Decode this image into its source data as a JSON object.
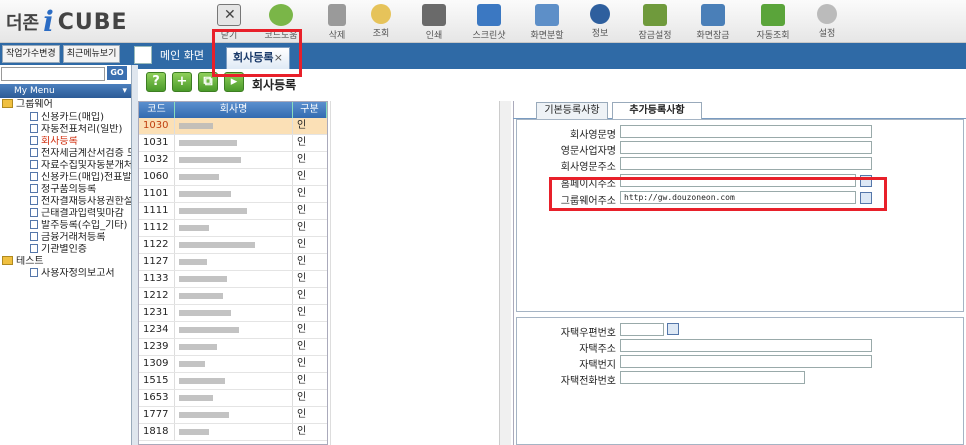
{
  "app": {
    "logo_brand": "더존",
    "logo_i": "i",
    "logo_product": "CUBE"
  },
  "toolbar": [
    {
      "label": "닫기",
      "icon": "close-window-icon"
    },
    {
      "label": "코드도움",
      "icon": "code-help-icon"
    },
    {
      "label": "삭제",
      "icon": "delete-icon"
    },
    {
      "label": "조회",
      "icon": "search-icon"
    },
    {
      "label": "인쇄",
      "icon": "printer-icon"
    },
    {
      "label": "스크린샷",
      "icon": "screenshot-icon"
    },
    {
      "label": "화면분할",
      "icon": "split-screen-icon"
    },
    {
      "label": "정보",
      "icon": "info-icon"
    },
    {
      "label": "잠금설정",
      "icon": "lock-settings-icon"
    },
    {
      "label": "화면잠금",
      "icon": "screen-lock-icon"
    },
    {
      "label": "자동조회",
      "icon": "auto-query-icon"
    },
    {
      "label": "설정",
      "icon": "gear-icon"
    }
  ],
  "left_tools": {
    "work_count_btn": "작업가수변경",
    "recent_menu_btn": "최근메뉴보기",
    "go_btn": "GO"
  },
  "tabs": {
    "main": "메인 화면",
    "company": "회사등록",
    "close": "×"
  },
  "mymenu": {
    "title": "My Menu"
  },
  "tree": [
    {
      "label": "그룹웨어",
      "type": "folder",
      "level": 0
    },
    {
      "label": "신용카드(매입)",
      "type": "page",
      "level": 1
    },
    {
      "label": "자동전표처리(일반)",
      "type": "page",
      "level": 1
    },
    {
      "label": "회사등록",
      "type": "page",
      "level": 1,
      "active": true
    },
    {
      "label": "전자세금계산서검증 도",
      "type": "page",
      "level": 1
    },
    {
      "label": "자료수집및자동분개처",
      "type": "page",
      "level": 1
    },
    {
      "label": "신용카드(매입)전표발",
      "type": "page",
      "level": 1
    },
    {
      "label": "청구품의등록",
      "type": "page",
      "level": 1
    },
    {
      "label": "전자결재등사용권한설",
      "type": "page",
      "level": 1
    },
    {
      "label": "근태결과입력및마감",
      "type": "page",
      "level": 1
    },
    {
      "label": "발주등록(수입_기타)",
      "type": "page",
      "level": 1
    },
    {
      "label": "금융거래처등록",
      "type": "page",
      "level": 1
    },
    {
      "label": "기관별인증",
      "type": "page",
      "level": 1
    },
    {
      "label": "테스트",
      "type": "folder",
      "level": 0
    },
    {
      "label": "사용자정의보고서",
      "type": "page",
      "level": 1
    }
  ],
  "page": {
    "title": "회사등록"
  },
  "grid": {
    "headers": [
      "코드",
      "회사명",
      "구분"
    ],
    "rows": [
      {
        "code": "1030",
        "type": "인",
        "selected": true
      },
      {
        "code": "1031",
        "type": "인"
      },
      {
        "code": "1032",
        "type": "인"
      },
      {
        "code": "1060",
        "type": "인"
      },
      {
        "code": "1101",
        "type": "인"
      },
      {
        "code": "1111",
        "type": "인"
      },
      {
        "code": "1112",
        "type": "인"
      },
      {
        "code": "1122",
        "type": "인"
      },
      {
        "code": "1127",
        "type": "인"
      },
      {
        "code": "1133",
        "type": "인"
      },
      {
        "code": "1212",
        "type": "인"
      },
      {
        "code": "1231",
        "type": "인"
      },
      {
        "code": "1234",
        "type": "인"
      },
      {
        "code": "1239",
        "type": "인"
      },
      {
        "code": "1309",
        "type": "인"
      },
      {
        "code": "1515",
        "type": "인"
      },
      {
        "code": "1653",
        "type": "인"
      },
      {
        "code": "1777",
        "type": "인"
      },
      {
        "code": "1818",
        "type": "인"
      }
    ]
  },
  "subtabs": {
    "basic": "기본등록사항",
    "extra": "추가등록사항"
  },
  "form_top": [
    {
      "label": "회사영문명",
      "value": ""
    },
    {
      "label": "영문사업자명",
      "value": ""
    },
    {
      "label": "회사영문주소",
      "value": ""
    },
    {
      "label": "홈페이지주소",
      "value": ""
    },
    {
      "label": "그룹웨어주소",
      "value": "http://gw.douzoneon.com"
    }
  ],
  "form_bottom": [
    {
      "label": "자택우편번호",
      "value": ""
    },
    {
      "label": "자택주소",
      "value": ""
    },
    {
      "label": "자택번지",
      "value": ""
    },
    {
      "label": "자택전화번호",
      "value": ""
    }
  ],
  "colors": {
    "nav_blue": "#2f6aa6",
    "highlight_red": "#e8202a",
    "selected_row": "#fbe0b6"
  }
}
